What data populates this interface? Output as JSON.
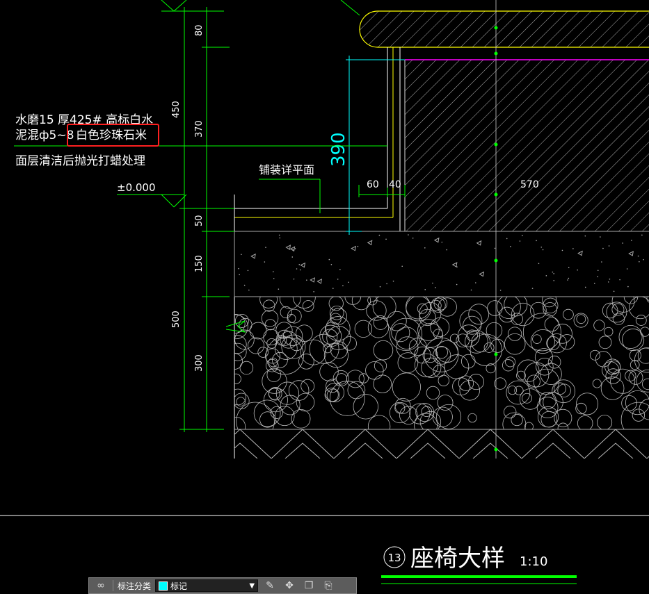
{
  "notes": {
    "line1": "水磨15 厚425# 高标白水",
    "line2_prefix": "泥混ф5~8",
    "line2_highlight": "白色珍珠石米",
    "line3": "面层清洁后抛光打蜡处理",
    "elevation": "±0.000",
    "paving_label": "铺装详平面"
  },
  "dimensions": {
    "d80": "80",
    "d450": "450",
    "d370": "370",
    "d50": "50",
    "d150": "150",
    "d500": "500",
    "d300": "300",
    "d390": "390",
    "d60": "60",
    "d40": "40",
    "d570": "570"
  },
  "title": {
    "number": "13",
    "text": "座椅大样",
    "scale": "1:10"
  },
  "toolbar": {
    "category_label": "标注分类",
    "selected": "标记",
    "swatch_color": "#00ffff"
  },
  "colors": {
    "dim": "#00ff00",
    "highlight": "#ff2020",
    "cyan": "#00ffff",
    "magenta": "#ff00ff",
    "yellow": "#ffff00"
  }
}
